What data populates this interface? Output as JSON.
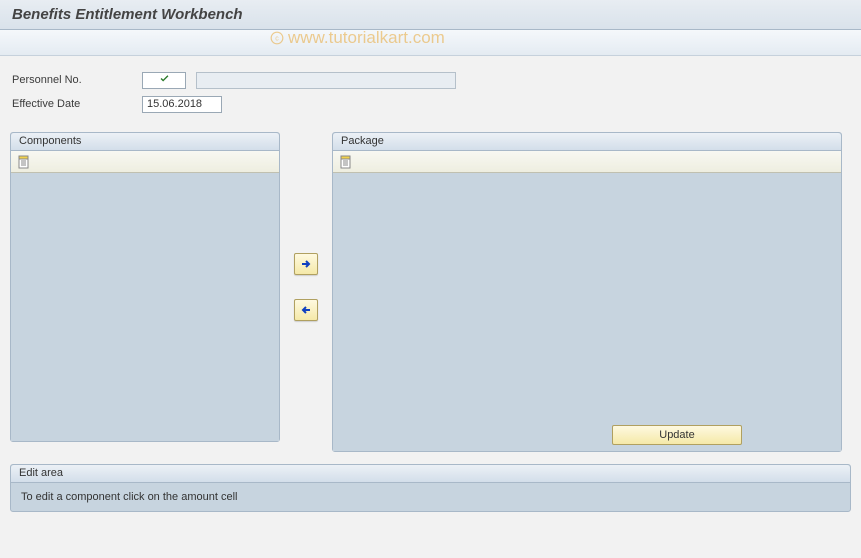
{
  "title": "Benefits Entitlement Workbench",
  "watermark": "www.tutorialkart.com",
  "form": {
    "personnel_no_label": "Personnel No.",
    "effective_date_label": "Effective Date",
    "effective_date_value": "15.06.2018"
  },
  "panels": {
    "components_title": "Components",
    "package_title": "Package",
    "update_button": "Update"
  },
  "edit_area": {
    "title": "Edit area",
    "hint": "To edit a component click on the amount cell"
  },
  "icons": {
    "check": "check-icon",
    "sheet": "sheet-icon",
    "arrow_right": "arrow-right-icon",
    "arrow_left": "arrow-left-icon"
  }
}
